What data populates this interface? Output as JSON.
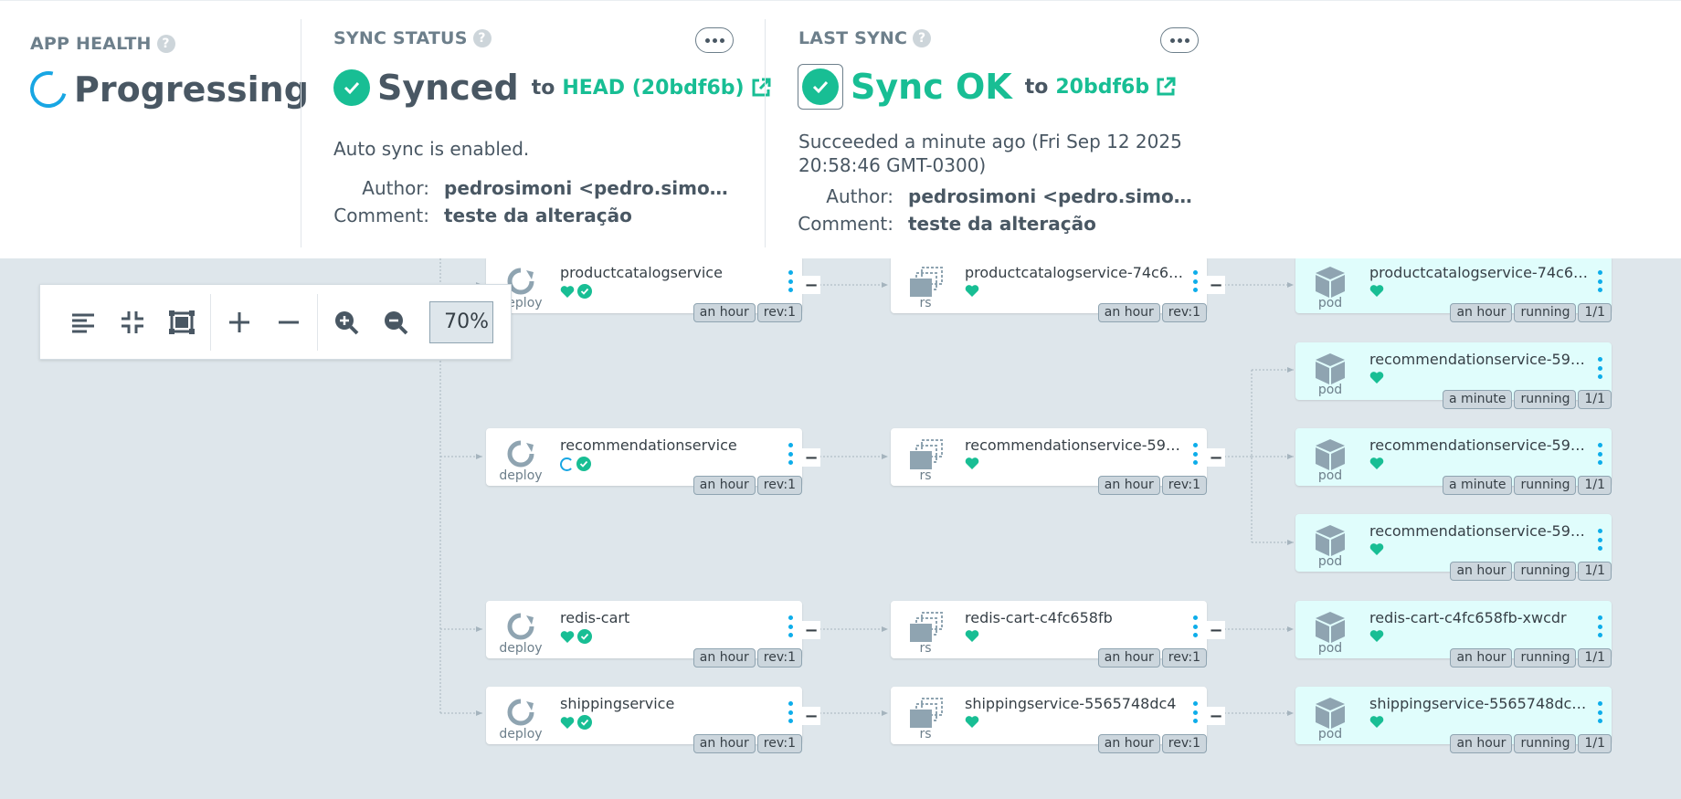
{
  "app_health": {
    "label": "APP HEALTH",
    "status": "Progressing"
  },
  "sync_status": {
    "label": "SYNC STATUS",
    "status": "Synced",
    "to": "to",
    "revision": "HEAD (20bdf6b)",
    "auto_sync": "Auto sync is enabled.",
    "author_key": "Author:",
    "author": "pedrosimoni <pedro.simoni.sc...",
    "comment_key": "Comment:",
    "comment": "teste da alteração"
  },
  "last_sync": {
    "label": "LAST SYNC",
    "status": "Sync OK",
    "to": "to",
    "revision": "20bdf6b",
    "succeeded": "Succeeded a minute ago (Fri Sep 12 2025 20:58:46 GMT-0300)",
    "author_key": "Author:",
    "author": "pedrosimoni <pedro.simoni.sc...",
    "comment_key": "Comment:",
    "comment": "teste da alteração"
  },
  "help_icon": "?",
  "collapse_glyph": "−",
  "toolbar": {
    "zoom": "70%",
    "icons": [
      "align-left-icon",
      "compress-icon",
      "fit-screen-icon",
      "expand-plus-icon",
      "collapse-minus-icon",
      "zoom-in-icon",
      "zoom-out-icon"
    ]
  },
  "colors": {
    "healthy": "#18be94",
    "progressing": "#18a6e3",
    "pod_bg": "#e0fdfc",
    "canvas_bg": "#dee6eb",
    "menu_dot": "#0dadea"
  },
  "nodes": {
    "deploy_productcatalog": {
      "name": "productcatalogservice",
      "kind": "deploy",
      "tags": [
        "an hour",
        "rev:1"
      ]
    },
    "rs_productcatalog": {
      "name": "productcatalogservice-74c67...",
      "kind": "rs",
      "tags": [
        "an hour",
        "rev:1"
      ]
    },
    "pod_productcatalog": {
      "name": "productcatalogservice-74c67...",
      "kind": "pod",
      "tags": [
        "an hour",
        "running",
        "1/1"
      ]
    },
    "pod_recommendation_1": {
      "name": "recommendationservice-5966...",
      "kind": "pod",
      "tags": [
        "a minute",
        "running",
        "1/1"
      ]
    },
    "deploy_recommendation": {
      "name": "recommendationservice",
      "kind": "deploy",
      "tags": [
        "an hour",
        "rev:1"
      ]
    },
    "rs_recommendation": {
      "name": "recommendationservice-5966...",
      "kind": "rs",
      "tags": [
        "an hour",
        "rev:1"
      ]
    },
    "pod_recommendation_2": {
      "name": "recommendationservice-5966...",
      "kind": "pod",
      "tags": [
        "a minute",
        "running",
        "1/1"
      ]
    },
    "pod_recommendation_3": {
      "name": "recommendationservice-5966...",
      "kind": "pod",
      "tags": [
        "an hour",
        "running",
        "1/1"
      ]
    },
    "deploy_redis": {
      "name": "redis-cart",
      "kind": "deploy",
      "tags": [
        "an hour",
        "rev:1"
      ]
    },
    "rs_redis": {
      "name": "redis-cart-c4fc658fb",
      "kind": "rs",
      "tags": [
        "an hour",
        "rev:1"
      ]
    },
    "pod_redis": {
      "name": "redis-cart-c4fc658fb-xwcdr",
      "kind": "pod",
      "tags": [
        "an hour",
        "running",
        "1/1"
      ]
    },
    "deploy_shipping": {
      "name": "shippingservice",
      "kind": "deploy",
      "tags": [
        "an hour",
        "rev:1"
      ]
    },
    "rs_shipping": {
      "name": "shippingservice-5565748dc4",
      "kind": "rs",
      "tags": [
        "an hour",
        "rev:1"
      ]
    },
    "pod_shipping": {
      "name": "shippingservice-5565748dc4-...",
      "kind": "pod",
      "tags": [
        "an hour",
        "running",
        "1/1"
      ]
    }
  }
}
